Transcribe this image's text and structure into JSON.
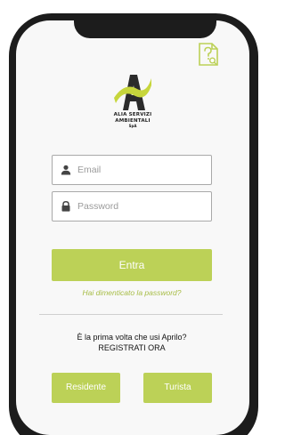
{
  "brand": {
    "line1": "ALIA SERVIZI",
    "line2": "AMBIENTALI",
    "line3": "SpA",
    "accent_color": "#bcd157",
    "logo_icon": "alia-logo-a"
  },
  "help": {
    "icon": "document-question-icon"
  },
  "login": {
    "email_placeholder": "Email",
    "password_placeholder": "Password",
    "submit_label": "Entra",
    "forgot_label": "Hai dimenticato la password?"
  },
  "register": {
    "prompt": "È la prima volta che usi Aprilo?",
    "cta": "REGISTRATI ORA"
  },
  "roles": {
    "resident_label": "Residente",
    "tourist_label": "Turista"
  }
}
